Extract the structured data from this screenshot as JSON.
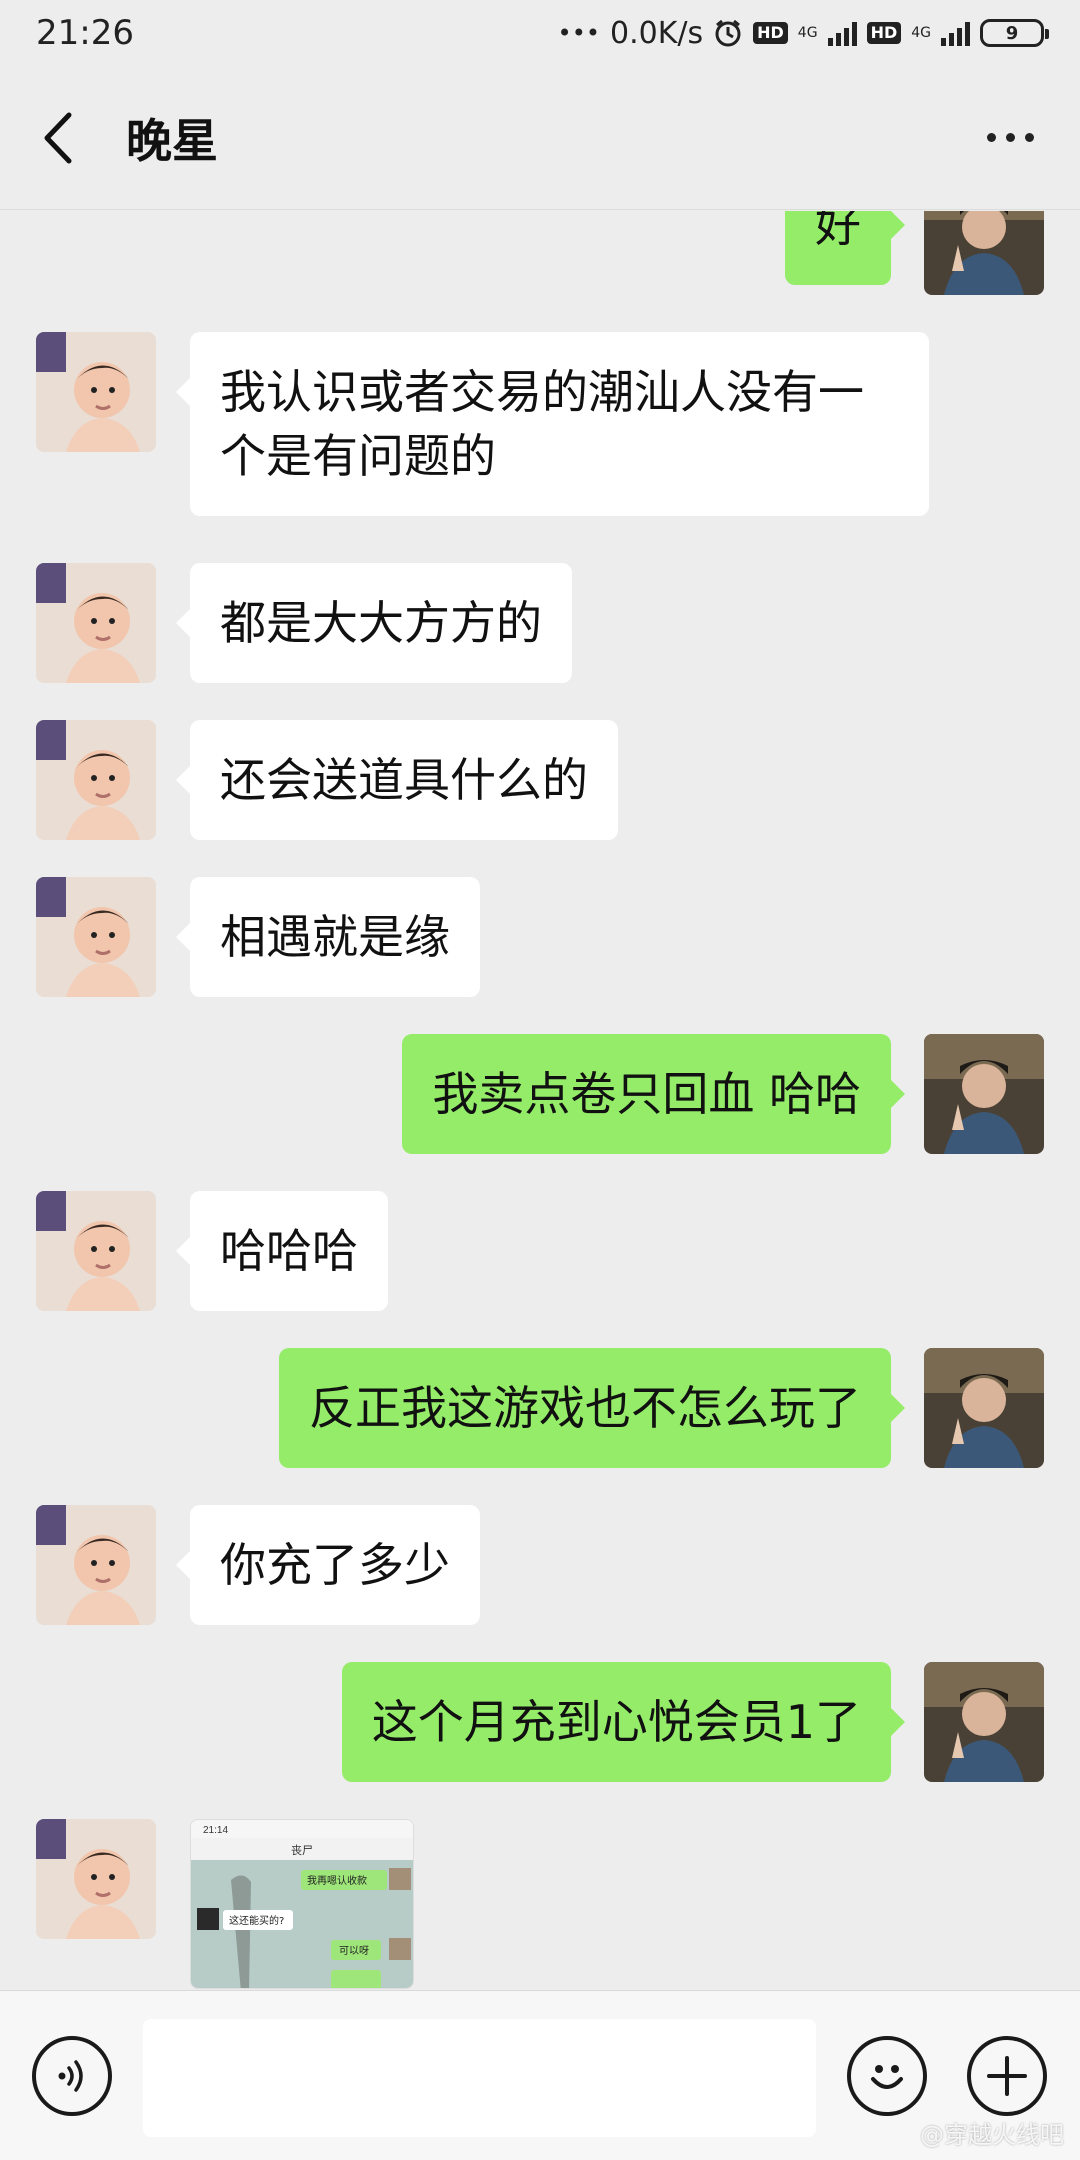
{
  "status_bar": {
    "time": "21:26",
    "dots": "•••",
    "speed": "0.0K/s",
    "hd1": "HD",
    "net1": "4G",
    "hd2": "HD",
    "net2": "4G",
    "battery": "9"
  },
  "header": {
    "title": "晚星"
  },
  "messages": [
    {
      "side": "out",
      "text": "好"
    },
    {
      "side": "in",
      "text": "我认识或者交易的潮汕人没有一个是有问题的"
    },
    {
      "side": "in",
      "text": "都是大大方方的"
    },
    {
      "side": "in",
      "text": "还会送道具什么的"
    },
    {
      "side": "in",
      "text": "相遇就是缘"
    },
    {
      "side": "out",
      "text": "我卖点卷只回血 哈哈"
    },
    {
      "side": "in",
      "text": "哈哈哈"
    },
    {
      "side": "out",
      "text": "反正我这游戏也不怎么玩了"
    },
    {
      "side": "in",
      "text": "你充了多少"
    },
    {
      "side": "out",
      "text": "这个月充到心悦会员1了"
    }
  ],
  "image_message": {
    "time": "21:14",
    "title": "丧尸",
    "bubble_1": "我再嗯认收款",
    "bubble_2": "这还能买的?",
    "bubble_3": "可以呀"
  },
  "input_bar": {
    "placeholder": ""
  },
  "watermark": "@穿越火线吧",
  "colors": {
    "chat_bg": "#ededed",
    "bubble_out": "#95ec69",
    "bubble_in": "#ffffff"
  }
}
